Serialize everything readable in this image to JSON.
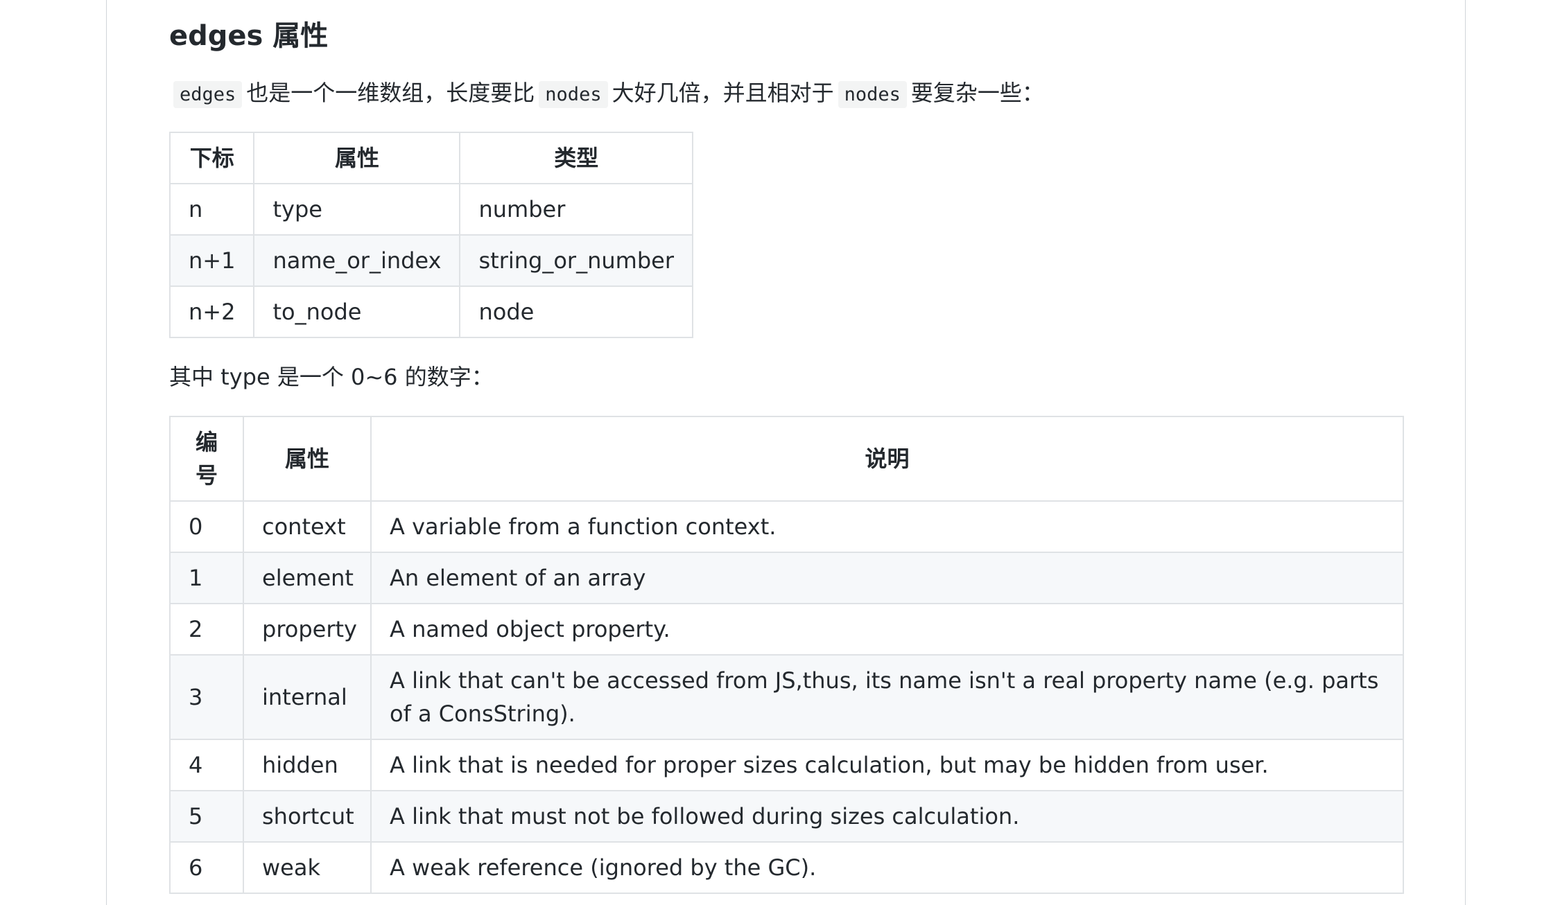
{
  "heading": "edges 属性",
  "intro": {
    "code1": "edges",
    "text1": "也是一个一维数组，长度要比",
    "code2": "nodes",
    "text2": "大好几倍，并且相对于",
    "code3": "nodes",
    "text3": "要复杂一些："
  },
  "table1": {
    "headers": [
      "下标",
      "属性",
      "类型"
    ],
    "rows": [
      [
        "n",
        "type",
        "number"
      ],
      [
        "n+1",
        "name_or_index",
        "string_or_number"
      ],
      [
        "n+2",
        "to_node",
        "node"
      ]
    ]
  },
  "type_note": "其中 type 是一个 0~6 的数字：",
  "table2": {
    "headers": [
      "编号",
      "属性",
      "说明"
    ],
    "rows": [
      [
        "0",
        "context",
        "A variable from a function context."
      ],
      [
        "1",
        "element",
        "An element of an array"
      ],
      [
        "2",
        "property",
        "A named object property."
      ],
      [
        "3",
        "internal",
        "A link that can't be accessed from JS,thus, its name isn't a real property name (e.g. parts of a ConsString)."
      ],
      [
        "4",
        "hidden",
        "A link that is needed for proper sizes calculation, but may be hidden from user."
      ],
      [
        "5",
        "shortcut",
        "A link that must not be followed during sizes calculation."
      ],
      [
        "6",
        "weak",
        "A weak reference (ignored by the GC)."
      ]
    ]
  }
}
